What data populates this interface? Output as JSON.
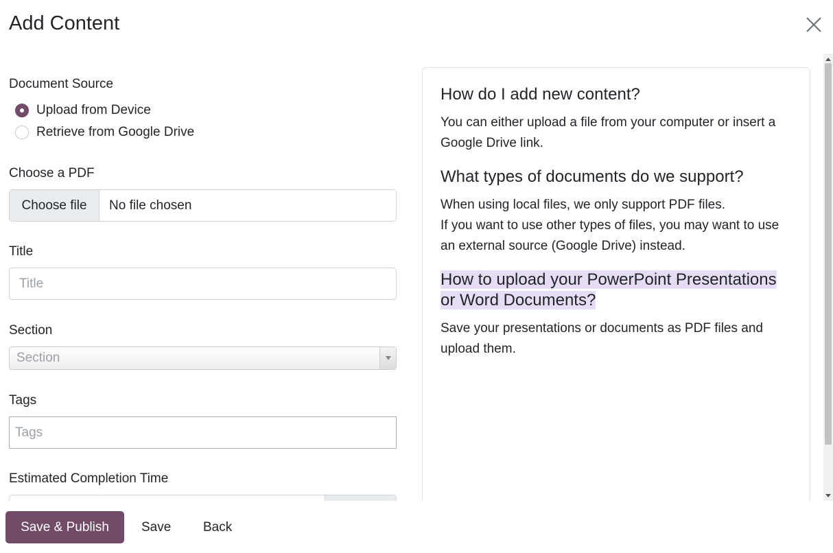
{
  "dialog": {
    "title": "Add Content",
    "close_icon": "close-icon"
  },
  "form": {
    "document_source": {
      "label": "Document Source",
      "options": [
        {
          "label": "Upload from Device",
          "checked": true
        },
        {
          "label": "Retrieve from Google Drive",
          "checked": false
        }
      ]
    },
    "pdf": {
      "label": "Choose a PDF",
      "button_label": "Choose file",
      "status": "No file chosen"
    },
    "title": {
      "label": "Title",
      "placeholder": "Title",
      "value": ""
    },
    "section": {
      "label": "Section",
      "placeholder": "Section"
    },
    "tags": {
      "label": "Tags",
      "placeholder": "Tags"
    },
    "completion_time": {
      "label": "Estimated Completion Time"
    }
  },
  "help": {
    "q1": "How do I add new content?",
    "a1": "You can either upload a file from your computer or insert a Google Drive link.",
    "q2": "What types of documents do we support?",
    "a2_line1": "When using local files, we only support PDF files.",
    "a2_line2": "If you want to use other types of files, you may want to use an external source (Google Drive) instead.",
    "q3_line1": "How to upload your PowerPoint Presentations",
    "q3_line2": "or Word Documents?",
    "a3": "Save your presentations or documents as PDF files and upload them."
  },
  "footer": {
    "save_publish_label": "Save & Publish",
    "save_label": "Save",
    "back_label": "Back"
  },
  "colors": {
    "brand": "#714b67",
    "highlight": "#e6dcf3"
  }
}
